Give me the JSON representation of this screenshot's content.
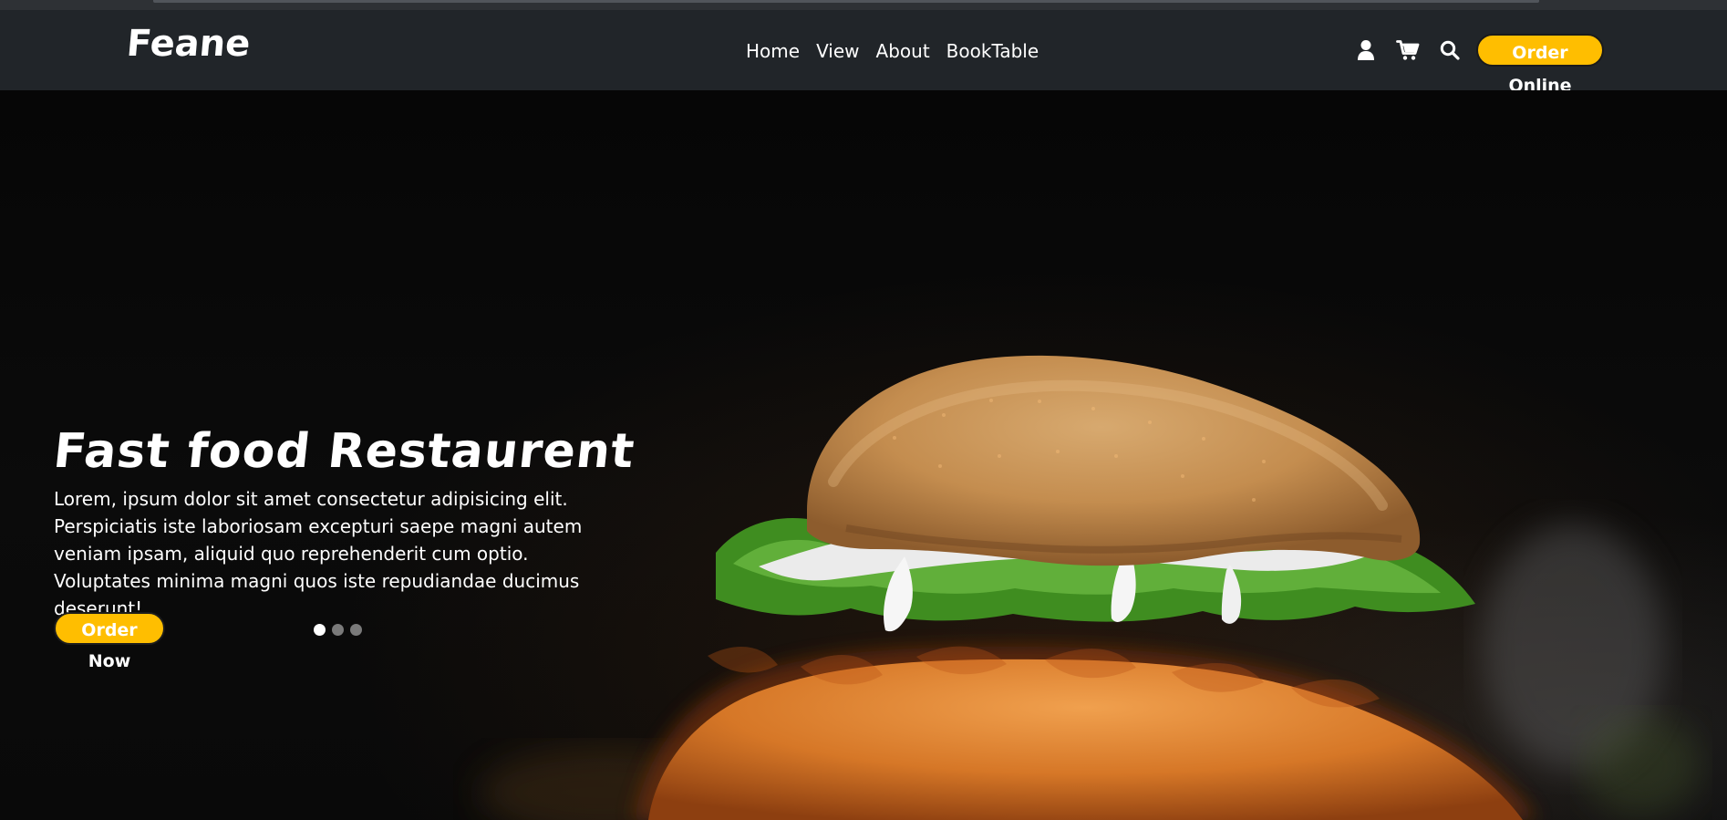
{
  "header": {
    "brand": "Feane",
    "nav": [
      {
        "label": "Home"
      },
      {
        "label": "View"
      },
      {
        "label": "About"
      },
      {
        "label": "BookTable"
      }
    ],
    "icons": [
      "user-icon",
      "cart-icon",
      "search-icon"
    ],
    "order_online_label": "Order Online"
  },
  "hero": {
    "title": "Fast food Restaurent",
    "description": "Lorem, ipsum dolor sit amet consectetur adipisicing elit. Perspiciatis iste laboriosam excepturi saepe magni autem veniam ipsam, aliquid quo reprehenderit cum optio. Voluptates minima magni quos iste repudiandae ducimus deserunt!",
    "cta_label": "Order Now",
    "carousel": {
      "slides": 3,
      "active_index": 0
    }
  },
  "colors": {
    "navbar": "#212529",
    "accent": "#ffbe00",
    "hero_background": "#070707",
    "text": "#ffffff"
  }
}
